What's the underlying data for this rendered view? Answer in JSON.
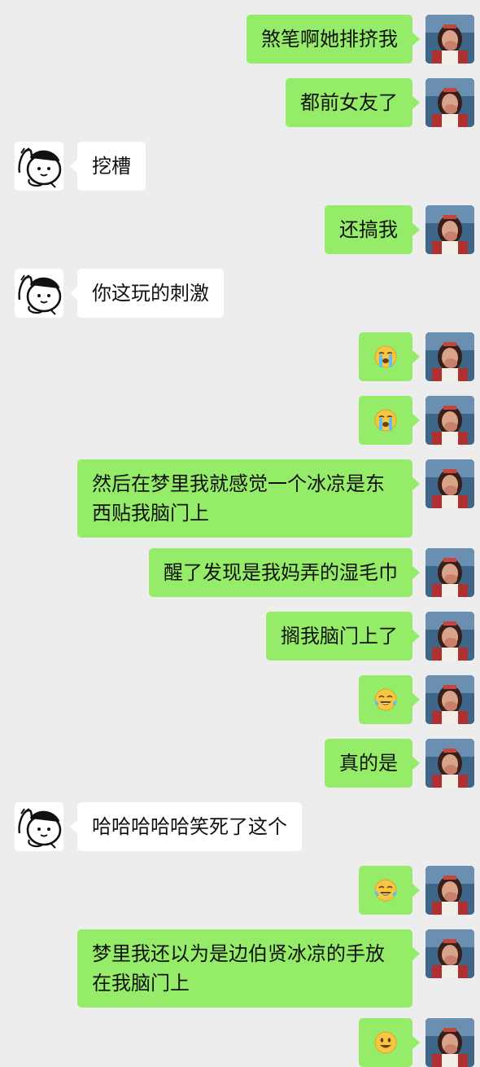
{
  "messages": [
    {
      "side": "me",
      "type": "text",
      "text": "煞笔啊她排挤我"
    },
    {
      "side": "me",
      "type": "text",
      "text": "都前女友了"
    },
    {
      "side": "other",
      "type": "text",
      "text": "挖槽"
    },
    {
      "side": "me",
      "type": "text",
      "text": "还搞我"
    },
    {
      "side": "other",
      "type": "text",
      "text": "你这玩的刺激"
    },
    {
      "side": "me",
      "type": "emoji",
      "icon": "crying-face-icon"
    },
    {
      "side": "me",
      "type": "emoji",
      "icon": "crying-face-icon"
    },
    {
      "side": "me",
      "type": "text",
      "text": "然后在梦里我就感觉一个冰凉是东西贴我脑门上"
    },
    {
      "side": "me",
      "type": "text",
      "text": "醒了发现是我妈弄的湿毛巾"
    },
    {
      "side": "me",
      "type": "text",
      "text": "搁我脑门上了"
    },
    {
      "side": "me",
      "type": "emoji",
      "icon": "tears-of-joy-icon"
    },
    {
      "side": "me",
      "type": "text",
      "text": "真的是"
    },
    {
      "side": "other",
      "type": "text",
      "text": "哈哈哈哈哈笑死了这个"
    },
    {
      "side": "me",
      "type": "emoji",
      "icon": "tears-of-joy-icon"
    },
    {
      "side": "me",
      "type": "text",
      "text": "梦里我还以为是边伯贤冰凉的手放在我脑门上"
    },
    {
      "side": "me",
      "type": "emoji",
      "icon": "grinning-face-icon"
    }
  ]
}
